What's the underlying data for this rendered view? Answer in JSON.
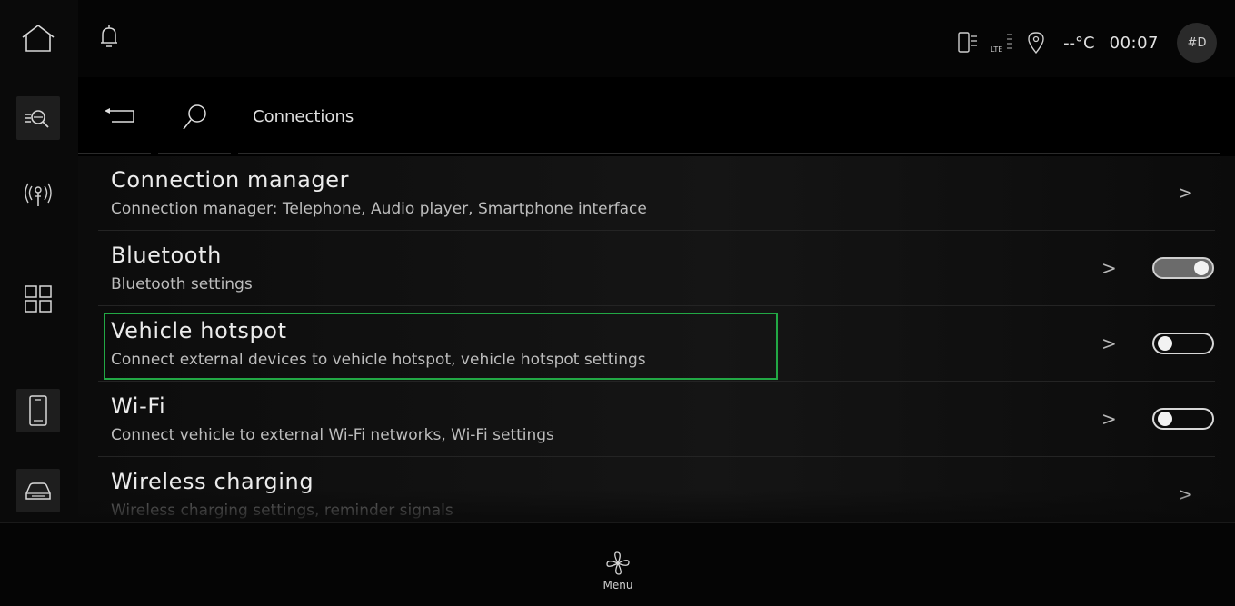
{
  "header": {
    "title": "Connections"
  },
  "status": {
    "temperature": "--°C",
    "time": "00:07",
    "profile": "#D",
    "network": "LTE"
  },
  "rail": {
    "icons": [
      "home-icon",
      "search-list-icon",
      "antenna-icon",
      "apps-grid-icon",
      "phone-icon",
      "car-icon"
    ]
  },
  "list": {
    "items": [
      {
        "title": "Connection manager",
        "subtitle": "Connection manager: Telephone, Audio player, Smartphone interface",
        "toggle": null
      },
      {
        "title": "Bluetooth",
        "subtitle": "Bluetooth settings",
        "toggle": "on"
      },
      {
        "title": "Vehicle hotspot",
        "subtitle": "Connect external devices to vehicle hotspot, vehicle hotspot settings",
        "toggle": "off",
        "highlighted": true
      },
      {
        "title": "Wi-Fi",
        "subtitle": "Connect vehicle to external Wi-Fi networks, Wi-Fi settings",
        "toggle": "off"
      },
      {
        "title": "Wireless charging",
        "subtitle": "Wireless charging settings, reminder signals",
        "toggle": null
      }
    ],
    "chevron": ">"
  },
  "bottom": {
    "menu_label": "Menu"
  },
  "colors": {
    "highlight": "#22a845",
    "background": "#000000"
  }
}
